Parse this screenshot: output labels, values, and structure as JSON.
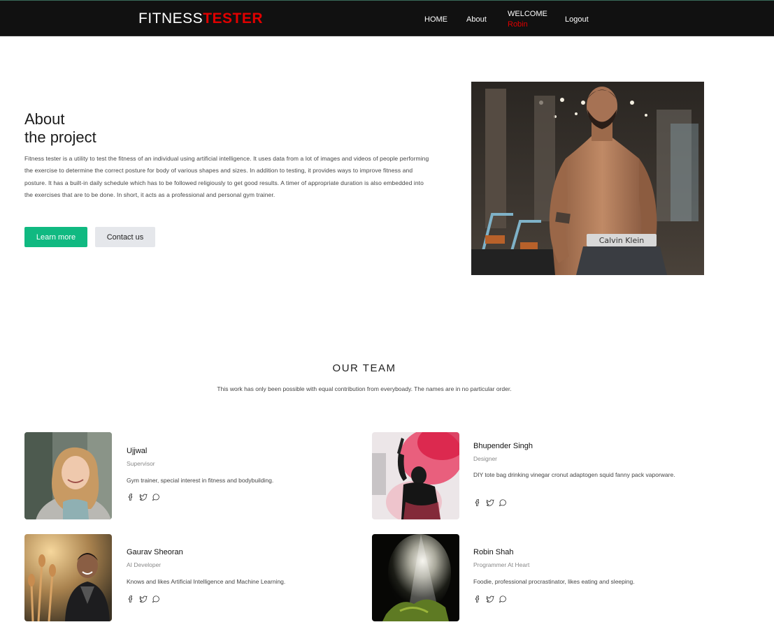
{
  "nav": {
    "brand_part1": "FITNESS",
    "brand_part2": "TESTER",
    "home": "HOME",
    "about": "About",
    "welcome": "WELCOME",
    "user": "Robin",
    "logout": "Logout"
  },
  "about": {
    "title_line1": "About",
    "title_line2": "the project",
    "text": "Fitness tester is a utility to test the fitness of an individual using artificial intelligence. It uses data from a lot of images and videos of people performing the exercise to determine the correct posture for body of various shapes and sizes. In addition to testing, it provides ways to improve fitness and posture. It has a built-in daily schedule which has to be followed religiously to get good results. A timer of appropriate duration is also embedded into the exercises that are to be done. In short, it acts as a professional and personal gym trainer.",
    "learn_more": "Learn more",
    "contact_us": "Contact us",
    "image_label": "Calvin Klein"
  },
  "team": {
    "title": "OUR TEAM",
    "subtitle": "This work has only been possible with equal contribution from everyboady. The names are in no particular order.",
    "members": [
      {
        "name": "Ujjwal",
        "role": "Supervisor",
        "desc": "Gym trainer, special interest in fitness and bodybuilding."
      },
      {
        "name": "Bhupender Singh",
        "role": "Designer",
        "desc": "DIY tote bag drinking vinegar cronut adaptogen squid fanny pack vaporware."
      },
      {
        "name": "Gaurav Sheoran",
        "role": "AI Developer",
        "desc": "Knows and likes Artificial Intelligence and Machine Learning."
      },
      {
        "name": "Robin Shah",
        "role": "Programmer At Heart",
        "desc": "Foodie, professional procrastinator, likes eating and sleeping."
      }
    ]
  },
  "colors": {
    "accent": "#10b981",
    "brand_red": "#e00000",
    "navbar": "#111111"
  }
}
